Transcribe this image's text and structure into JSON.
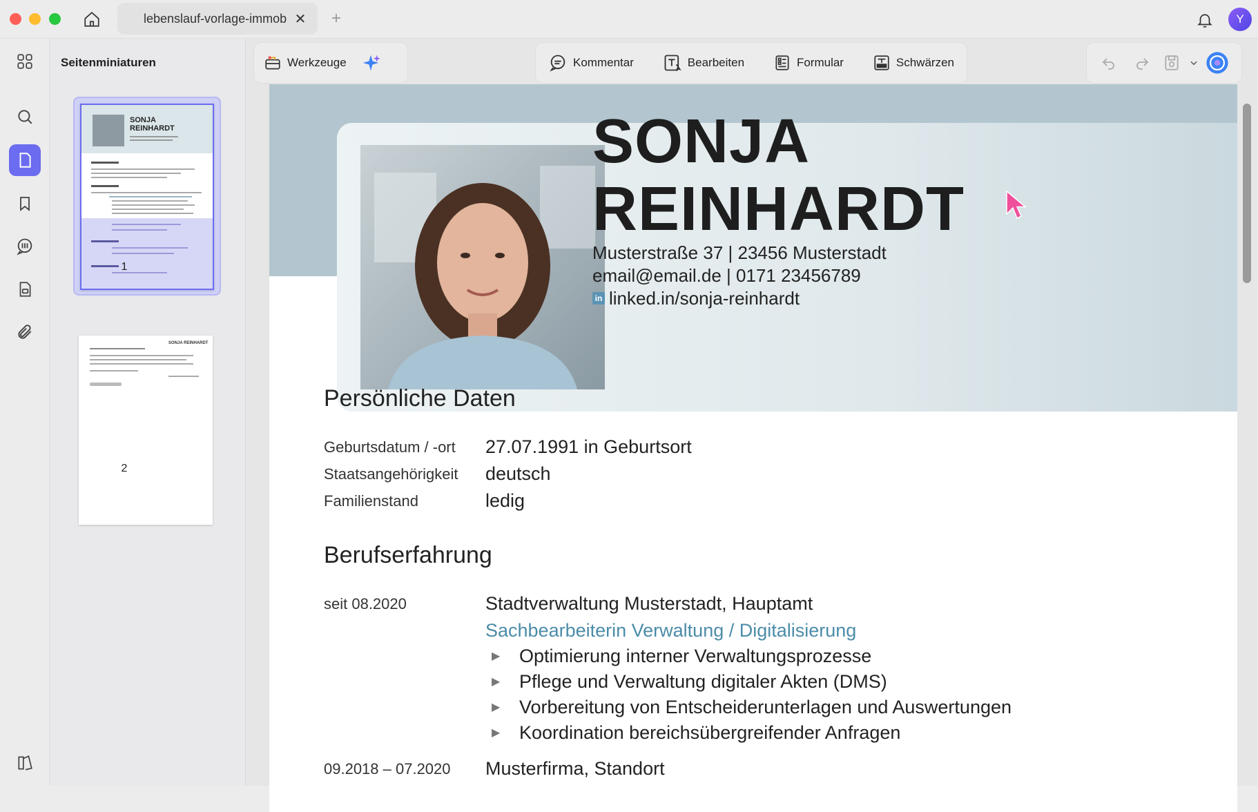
{
  "window": {
    "tab_title": "lebenslauf-vorlage-immob",
    "new_tab": "+",
    "close": "✕",
    "user_initial": "Y"
  },
  "sidebar": {
    "title": "Seitenminiaturen",
    "pages": [
      "1",
      "2"
    ]
  },
  "toolbar": {
    "tools_label": "Werkzeuge",
    "comment_label": "Kommentar",
    "edit_label": "Bearbeiten",
    "form_label": "Formular",
    "redact_label": "Schwärzen"
  },
  "document": {
    "first_name": "SONJA",
    "last_name": "REINHARDT",
    "address": "Musterstraße 37 | 23456 Musterstadt",
    "email_phone": "email@email.de | 0171 23456789",
    "linkedin": "linked.in/sonja-reinhardt",
    "linkedin_badge": "in",
    "personal_title": "Persönliche Daten",
    "personal": [
      {
        "label": "Geburtsdatum / -ort",
        "value": "27.07.1991 in Geburtsort"
      },
      {
        "label": "Staatsangehörigkeit",
        "value": "deutsch"
      },
      {
        "label": "Familienstand",
        "value": "ledig"
      }
    ],
    "experience_title": "Berufserfahrung",
    "experience": {
      "date": "seit 08.2020",
      "employer": "Stadtverwaltung Musterstadt, Hauptamt",
      "role": "Sachbearbeiterin Verwaltung / Digitalisierung",
      "bullets": [
        "Optimierung interner Verwaltungsprozesse",
        "Pflege und Verwaltung digitaler Akten (DMS)",
        "Vorbereitung von Entscheiderunterlagen und Auswertungen",
        "Koordination bereichsübergreifender Anfragen"
      ],
      "bullet_glyph": "▶",
      "next_date": "09.2018 – 07.2020",
      "next_employer": "Musterfirma, Standort"
    }
  },
  "thumbnail_text": {
    "name1": "SONJA",
    "name2": "REINHARDT",
    "page2_header": "SONJA REINHARDT"
  },
  "colors": {
    "accent": "#6b6cf0",
    "banner": "#b3c6cf",
    "role_text": "#4b8ca8"
  }
}
